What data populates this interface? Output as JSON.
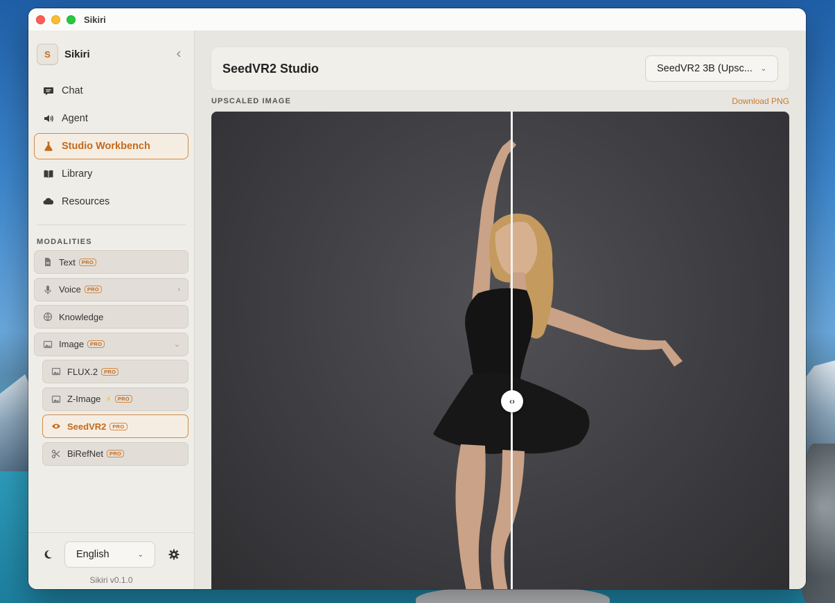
{
  "window": {
    "title": "Sikiri"
  },
  "sidebar": {
    "brand_initial": "S",
    "brand_name": "Sikiri",
    "nav": [
      {
        "label": "Chat",
        "icon": "chat-bubble-icon"
      },
      {
        "label": "Agent",
        "icon": "speaker-icon"
      },
      {
        "label": "Studio Workbench",
        "icon": "flask-icon",
        "active": true
      },
      {
        "label": "Library",
        "icon": "book-icon"
      },
      {
        "label": "Resources",
        "icon": "cloud-icon"
      }
    ],
    "modalities_title": "MODALITIES",
    "modalities": [
      {
        "label": "Text",
        "badge": "PRO",
        "icon": "document-icon"
      },
      {
        "label": "Voice",
        "badge": "PRO",
        "icon": "microphone-icon",
        "chevron": "›"
      },
      {
        "label": "Knowledge",
        "icon": "globe-icon"
      },
      {
        "label": "Image",
        "badge": "PRO",
        "icon": "image-icon",
        "chevron": "⌄"
      },
      {
        "label": "FLUX.2",
        "badge": "PRO",
        "icon": "image-icon"
      },
      {
        "label": "Z-Image",
        "badge": "PRO",
        "icon": "image-icon",
        "extra": "⚡"
      },
      {
        "label": "SeedVR2",
        "badge": "PRO",
        "icon": "eye-icon",
        "active": true
      },
      {
        "label": "BiRefNet",
        "badge": "PRO",
        "icon": "scissors-icon"
      }
    ],
    "footer": {
      "language": "English",
      "version": "Sikiri v0.1.0"
    }
  },
  "main": {
    "title": "SeedVR2 Studio",
    "model_select": "SeedVR2 3B (Upsc...",
    "section_label": "UPSCALED IMAGE",
    "download_label": "Download PNG",
    "compare_handle": "‹›"
  },
  "colors": {
    "accent": "#c26a1c",
    "accent_border": "#d08a47",
    "sidebar_bg": "#efede7"
  }
}
